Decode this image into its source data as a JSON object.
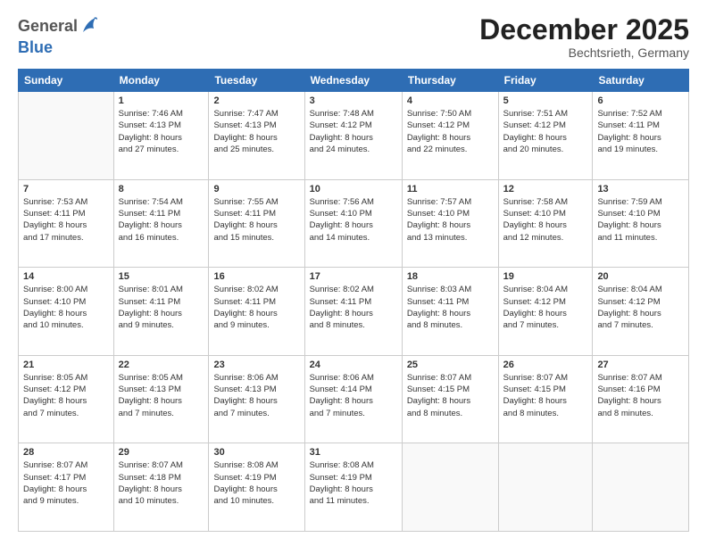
{
  "header": {
    "logo_general": "General",
    "logo_blue": "Blue",
    "month": "December 2025",
    "location": "Bechtsrieth, Germany"
  },
  "days_of_week": [
    "Sunday",
    "Monday",
    "Tuesday",
    "Wednesday",
    "Thursday",
    "Friday",
    "Saturday"
  ],
  "weeks": [
    [
      {
        "day": "",
        "content": ""
      },
      {
        "day": "1",
        "content": "Sunrise: 7:46 AM\nSunset: 4:13 PM\nDaylight: 8 hours\nand 27 minutes."
      },
      {
        "day": "2",
        "content": "Sunrise: 7:47 AM\nSunset: 4:13 PM\nDaylight: 8 hours\nand 25 minutes."
      },
      {
        "day": "3",
        "content": "Sunrise: 7:48 AM\nSunset: 4:12 PM\nDaylight: 8 hours\nand 24 minutes."
      },
      {
        "day": "4",
        "content": "Sunrise: 7:50 AM\nSunset: 4:12 PM\nDaylight: 8 hours\nand 22 minutes."
      },
      {
        "day": "5",
        "content": "Sunrise: 7:51 AM\nSunset: 4:12 PM\nDaylight: 8 hours\nand 20 minutes."
      },
      {
        "day": "6",
        "content": "Sunrise: 7:52 AM\nSunset: 4:11 PM\nDaylight: 8 hours\nand 19 minutes."
      }
    ],
    [
      {
        "day": "7",
        "content": "Sunrise: 7:53 AM\nSunset: 4:11 PM\nDaylight: 8 hours\nand 17 minutes."
      },
      {
        "day": "8",
        "content": "Sunrise: 7:54 AM\nSunset: 4:11 PM\nDaylight: 8 hours\nand 16 minutes."
      },
      {
        "day": "9",
        "content": "Sunrise: 7:55 AM\nSunset: 4:11 PM\nDaylight: 8 hours\nand 15 minutes."
      },
      {
        "day": "10",
        "content": "Sunrise: 7:56 AM\nSunset: 4:10 PM\nDaylight: 8 hours\nand 14 minutes."
      },
      {
        "day": "11",
        "content": "Sunrise: 7:57 AM\nSunset: 4:10 PM\nDaylight: 8 hours\nand 13 minutes."
      },
      {
        "day": "12",
        "content": "Sunrise: 7:58 AM\nSunset: 4:10 PM\nDaylight: 8 hours\nand 12 minutes."
      },
      {
        "day": "13",
        "content": "Sunrise: 7:59 AM\nSunset: 4:10 PM\nDaylight: 8 hours\nand 11 minutes."
      }
    ],
    [
      {
        "day": "14",
        "content": "Sunrise: 8:00 AM\nSunset: 4:10 PM\nDaylight: 8 hours\nand 10 minutes."
      },
      {
        "day": "15",
        "content": "Sunrise: 8:01 AM\nSunset: 4:11 PM\nDaylight: 8 hours\nand 9 minutes."
      },
      {
        "day": "16",
        "content": "Sunrise: 8:02 AM\nSunset: 4:11 PM\nDaylight: 8 hours\nand 9 minutes."
      },
      {
        "day": "17",
        "content": "Sunrise: 8:02 AM\nSunset: 4:11 PM\nDaylight: 8 hours\nand 8 minutes."
      },
      {
        "day": "18",
        "content": "Sunrise: 8:03 AM\nSunset: 4:11 PM\nDaylight: 8 hours\nand 8 minutes."
      },
      {
        "day": "19",
        "content": "Sunrise: 8:04 AM\nSunset: 4:12 PM\nDaylight: 8 hours\nand 7 minutes."
      },
      {
        "day": "20",
        "content": "Sunrise: 8:04 AM\nSunset: 4:12 PM\nDaylight: 8 hours\nand 7 minutes."
      }
    ],
    [
      {
        "day": "21",
        "content": "Sunrise: 8:05 AM\nSunset: 4:12 PM\nDaylight: 8 hours\nand 7 minutes."
      },
      {
        "day": "22",
        "content": "Sunrise: 8:05 AM\nSunset: 4:13 PM\nDaylight: 8 hours\nand 7 minutes."
      },
      {
        "day": "23",
        "content": "Sunrise: 8:06 AM\nSunset: 4:13 PM\nDaylight: 8 hours\nand 7 minutes."
      },
      {
        "day": "24",
        "content": "Sunrise: 8:06 AM\nSunset: 4:14 PM\nDaylight: 8 hours\nand 7 minutes."
      },
      {
        "day": "25",
        "content": "Sunrise: 8:07 AM\nSunset: 4:15 PM\nDaylight: 8 hours\nand 8 minutes."
      },
      {
        "day": "26",
        "content": "Sunrise: 8:07 AM\nSunset: 4:15 PM\nDaylight: 8 hours\nand 8 minutes."
      },
      {
        "day": "27",
        "content": "Sunrise: 8:07 AM\nSunset: 4:16 PM\nDaylight: 8 hours\nand 8 minutes."
      }
    ],
    [
      {
        "day": "28",
        "content": "Sunrise: 8:07 AM\nSunset: 4:17 PM\nDaylight: 8 hours\nand 9 minutes."
      },
      {
        "day": "29",
        "content": "Sunrise: 8:07 AM\nSunset: 4:18 PM\nDaylight: 8 hours\nand 10 minutes."
      },
      {
        "day": "30",
        "content": "Sunrise: 8:08 AM\nSunset: 4:19 PM\nDaylight: 8 hours\nand 10 minutes."
      },
      {
        "day": "31",
        "content": "Sunrise: 8:08 AM\nSunset: 4:19 PM\nDaylight: 8 hours\nand 11 minutes."
      },
      {
        "day": "",
        "content": ""
      },
      {
        "day": "",
        "content": ""
      },
      {
        "day": "",
        "content": ""
      }
    ]
  ]
}
